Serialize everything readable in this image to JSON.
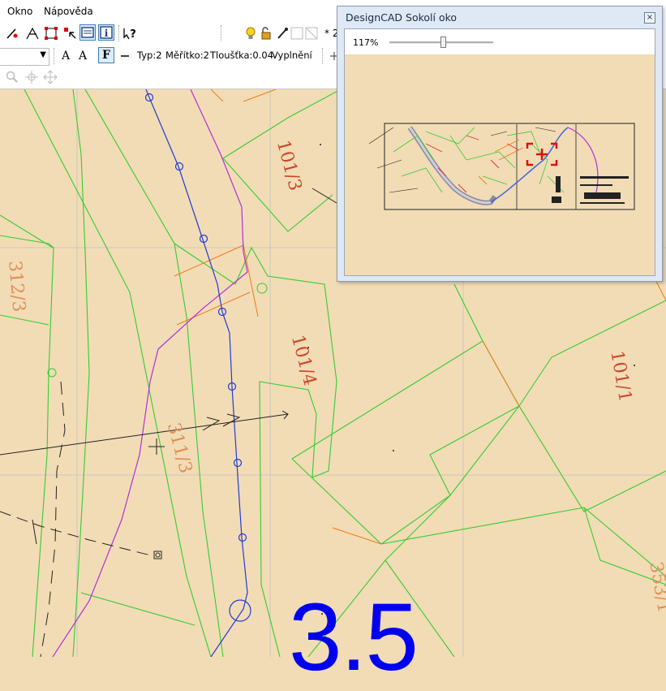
{
  "menu": {
    "items": [
      {
        "label": "Okno",
        "accel": "O"
      },
      {
        "label": "Nápověda",
        "accel": "N"
      }
    ]
  },
  "toolbar": {
    "counter": "* 2",
    "style_a_label": "A",
    "style_a2_label": "A",
    "fill_toggle_label": "F",
    "help_label": "?"
  },
  "properties": {
    "type": "Typ:2",
    "scale": "Měřítko:2",
    "thickness": "Tloušťka:0.04",
    "fill": "Vyplnění"
  },
  "canvas": {
    "parcels": [
      "101/3",
      "312/3",
      "101/4",
      "311/3",
      "101/1",
      "353/1"
    ],
    "big_label": "3.5",
    "big_label_color": "#0000f0"
  },
  "panel": {
    "title": "DesignCAD Sokolí oko",
    "close_glyph": "×",
    "zoom_label": "117%",
    "zoom_level_fraction": 0.52
  },
  "colors": {
    "background": "#f2dcb5",
    "green_lines": "#33cc33",
    "blue_lines": "#1f3bd6",
    "magenta_lines": "#b030d8",
    "orange_lines": "#f07a1a"
  }
}
